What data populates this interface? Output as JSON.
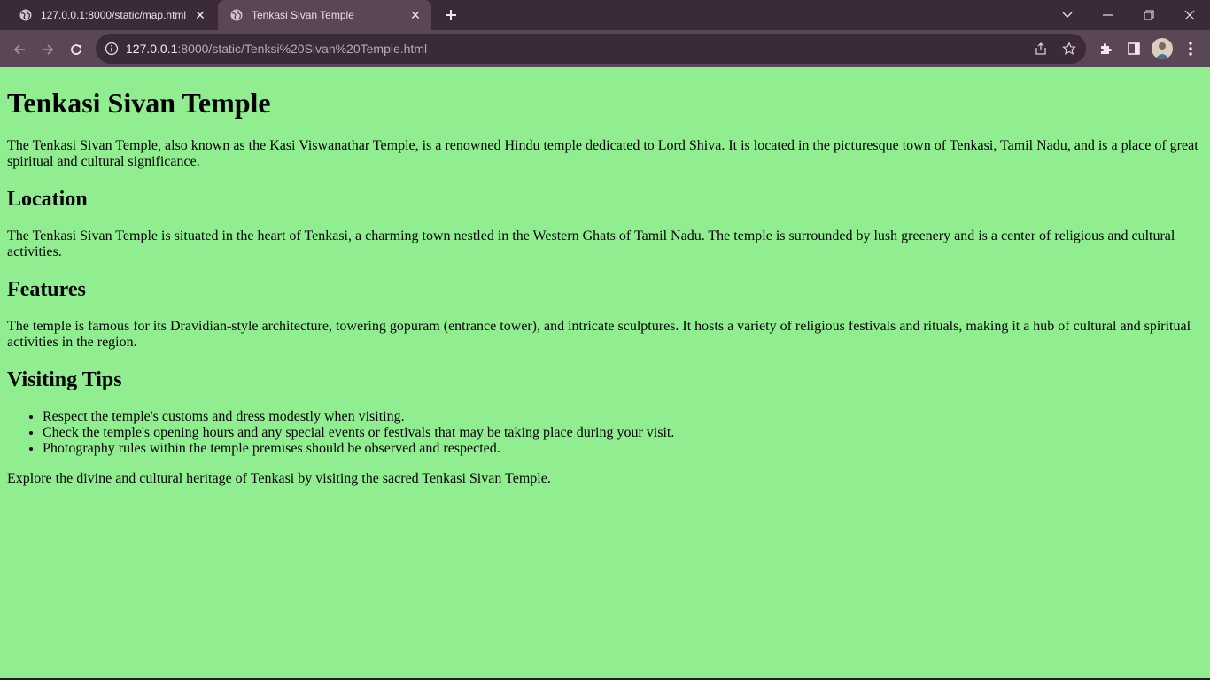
{
  "browser": {
    "tabs": [
      {
        "title": "127.0.0.1:8000/static/map.html",
        "active": false,
        "favicon": "globe-icon"
      },
      {
        "title": "Tenkasi Sivan Temple",
        "active": true,
        "favicon": "globe-icon"
      }
    ],
    "address": {
      "host": "127.0.0.1",
      "path": ":8000/static/Tenksi%20Sivan%20Temple.html"
    }
  },
  "page": {
    "title": "Tenkasi Sivan Temple",
    "intro": "The Tenkasi Sivan Temple, also known as the Kasi Viswanathar Temple, is a renowned Hindu temple dedicated to Lord Shiva. It is located in the picturesque town of Tenkasi, Tamil Nadu, and is a place of great spiritual and cultural significance.",
    "location_heading": "Location",
    "location_text": "The Tenkasi Sivan Temple is situated in the heart of Tenkasi, a charming town nestled in the Western Ghats of Tamil Nadu. The temple is surrounded by lush greenery and is a center of religious and cultural activities.",
    "features_heading": "Features",
    "features_text": "The temple is famous for its Dravidian-style architecture, towering gopuram (entrance tower), and intricate sculptures. It hosts a variety of religious festivals and rituals, making it a hub of cultural and spiritual activities in the region.",
    "tips_heading": "Visiting Tips",
    "tips": [
      "Respect the temple's customs and dress modestly when visiting.",
      "Check the temple's opening hours and any special events or festivals that may be taking place during your visit.",
      "Photography rules within the temple premises should be observed and respected."
    ],
    "closing": "Explore the divine and cultural heritage of Tenkasi by visiting the sacred Tenkasi Sivan Temple."
  },
  "colors": {
    "page_background": "#90ee90",
    "tabstrip": "#3a2a3a",
    "toolbar": "#5a4756"
  }
}
